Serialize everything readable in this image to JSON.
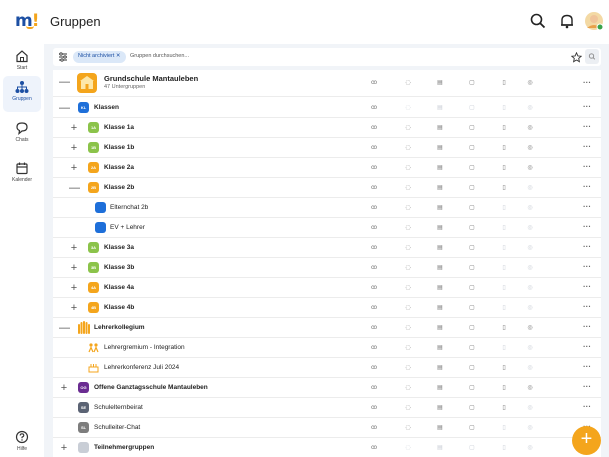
{
  "app": {
    "title": "Gruppen"
  },
  "sidebar": {
    "items": [
      {
        "label": "Start",
        "icon": "home-icon"
      },
      {
        "label": "Gruppen",
        "icon": "groups-icon",
        "active": true
      },
      {
        "label": "Chats",
        "icon": "chat-icon"
      },
      {
        "label": "Kalender",
        "icon": "calendar-icon"
      }
    ],
    "help": {
      "label": "Hilfe",
      "icon": "help-icon"
    }
  },
  "filter": {
    "chip_label": "Nicht archiviert",
    "search_placeholder": "Gruppen durchsuchen..."
  },
  "header_group": {
    "name": "Grundschule Mantauleben",
    "subtitle": "47 Untergruppen"
  },
  "rows": [
    {
      "badge": "KL",
      "name": "Klassen"
    },
    {
      "badge": "1A",
      "name": "Klasse 1a"
    },
    {
      "badge": "1B",
      "name": "Klasse 1b"
    },
    {
      "badge": "2A",
      "name": "Klasse 2a"
    },
    {
      "badge": "2B",
      "name": "Klasse 2b"
    },
    {
      "badge": "",
      "name": "Elternchat 2b"
    },
    {
      "badge": "",
      "name": "EV + Lehrer"
    },
    {
      "badge": "3A",
      "name": "Klasse 3a"
    },
    {
      "badge": "3B",
      "name": "Klasse 3b"
    },
    {
      "badge": "4A",
      "name": "Klasse 4a"
    },
    {
      "badge": "4B",
      "name": "Klasse 4b"
    },
    {
      "badge": "",
      "name": "Lehrerkollegium"
    },
    {
      "badge": "",
      "name": "Lehrergremium - Integration"
    },
    {
      "badge": "",
      "name": "Lehrerkonferenz Juli 2024"
    },
    {
      "badge": "OG",
      "name": "Offene Ganztagsschule Mantauleben"
    },
    {
      "badge": "SE",
      "name": "Schulelternbeirat"
    },
    {
      "badge": "SL",
      "name": "Schulleiter-Chat"
    },
    {
      "badge": "",
      "name": "Teilnehmergruppen"
    }
  ],
  "colors": {
    "accent": "#1c4fa3",
    "fab": "#f4a51c",
    "badge_blue": "#1e6fd9",
    "badge_green": "#8bc34a",
    "badge_orange": "#f4a51c",
    "badge_purple": "#6a2c91",
    "badge_gray": "#7d7d7d"
  }
}
